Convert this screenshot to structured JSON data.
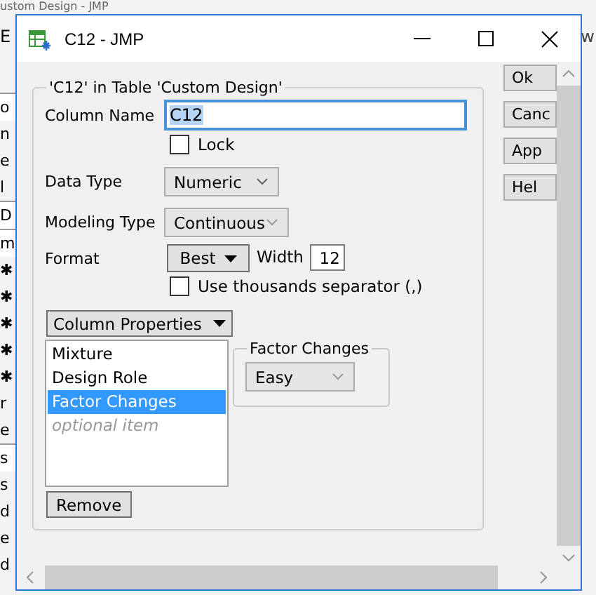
{
  "background_window": {
    "title": "ustom Design - JMP",
    "menu_left": "E",
    "menu_right": "w",
    "side_fragments": [
      {
        "text": "o",
        "kind": "boxed"
      },
      {
        "text": "n",
        "kind": "plain"
      },
      {
        "text": "e",
        "kind": "plain"
      },
      {
        "text": "l",
        "kind": "plain"
      },
      {
        "text": "D",
        "kind": "boxed"
      },
      {
        "text": "m",
        "kind": "boxed"
      },
      {
        "text": "✱",
        "kind": "plain"
      },
      {
        "text": "✱",
        "kind": "plain"
      },
      {
        "text": "✱",
        "kind": "plain"
      },
      {
        "text": "✱",
        "kind": "plain"
      },
      {
        "text": "✱",
        "kind": "plain"
      },
      {
        "text": "r",
        "kind": "plain"
      },
      {
        "text": "e",
        "kind": "plain"
      },
      {
        "text": "s",
        "kind": "boxed"
      },
      {
        "text": "s",
        "kind": "plain"
      },
      {
        "text": "d",
        "kind": "plain"
      },
      {
        "text": "e",
        "kind": "plain"
      },
      {
        "text": "d",
        "kind": "plain"
      }
    ]
  },
  "dialog": {
    "title": "C12 - JMP",
    "group_title": "'C12' in Table 'Custom Design'",
    "column_name": {
      "label": "Column Name",
      "value": "C12"
    },
    "lock": {
      "label": "Lock",
      "checked": false
    },
    "data_type": {
      "label": "Data Type",
      "value": "Numeric"
    },
    "modeling_type": {
      "label": "Modeling Type",
      "value": "Continuous"
    },
    "format": {
      "label": "Format",
      "value": "Best",
      "width_label": "Width",
      "width_value": "12"
    },
    "thousands_separator": {
      "label": "Use thousands separator (,)",
      "checked": false
    },
    "column_properties_button": "Column Properties",
    "properties_list": [
      {
        "label": "Mixture",
        "selected": false,
        "kind": "item"
      },
      {
        "label": "Design Role",
        "selected": false,
        "kind": "item"
      },
      {
        "label": "Factor Changes",
        "selected": true,
        "kind": "item"
      },
      {
        "label": "optional item",
        "selected": false,
        "kind": "placeholder"
      }
    ],
    "factor_changes": {
      "title": "Factor Changes",
      "value": "Easy"
    },
    "remove_button": "Remove",
    "buttons": [
      "Ok",
      "Canc",
      "App",
      "Hel"
    ]
  }
}
